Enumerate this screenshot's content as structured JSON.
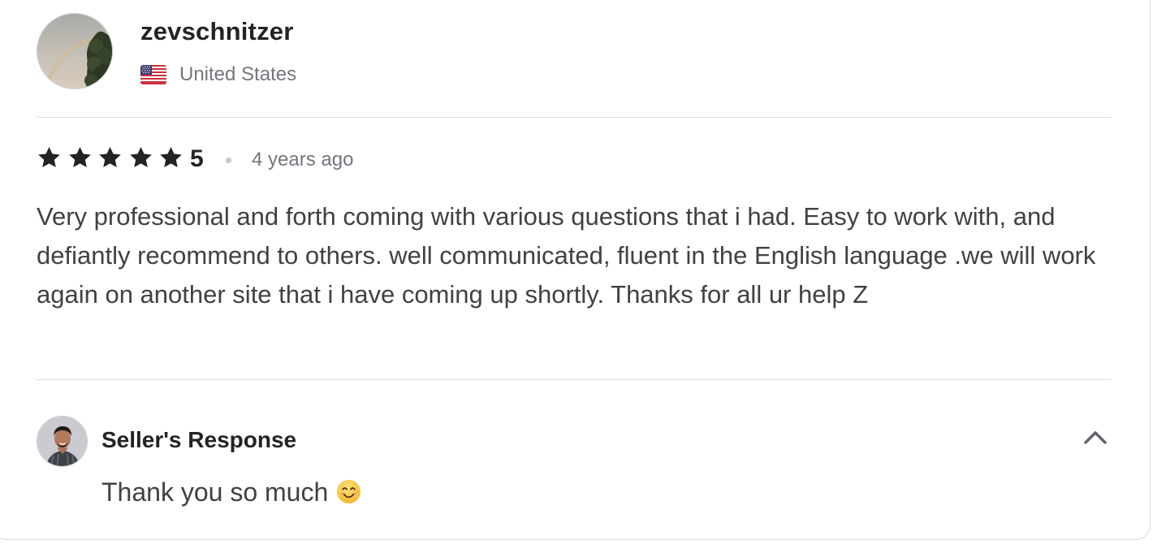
{
  "review": {
    "reviewer": {
      "username": "zevschnitzer",
      "country": "United States",
      "flag_icon": "us-flag-icon",
      "avatar_icon": "reviewer-avatar-photo"
    },
    "rating": {
      "stars": 5,
      "score_label": "5",
      "star_icon": "star-icon",
      "time_ago": "4 years ago"
    },
    "text": "Very professional and forth coming with various questions that i had. Easy to work with, and defiantly recommend to others. well communicated, fluent in the English language .we will work again on another site that i have coming up shortly. Thanks for all ur help Z"
  },
  "seller_response": {
    "title": "Seller's Response",
    "text": "Thank you so much",
    "emoji_icon": "smiling-face-icon",
    "avatar_icon": "seller-avatar-photo",
    "toggle_icon": "chevron-up-icon"
  },
  "colors": {
    "text_dark": "#222325",
    "text_body": "#404145",
    "text_muted": "#74767e",
    "divider": "#dadbdd",
    "star": "#222325"
  }
}
